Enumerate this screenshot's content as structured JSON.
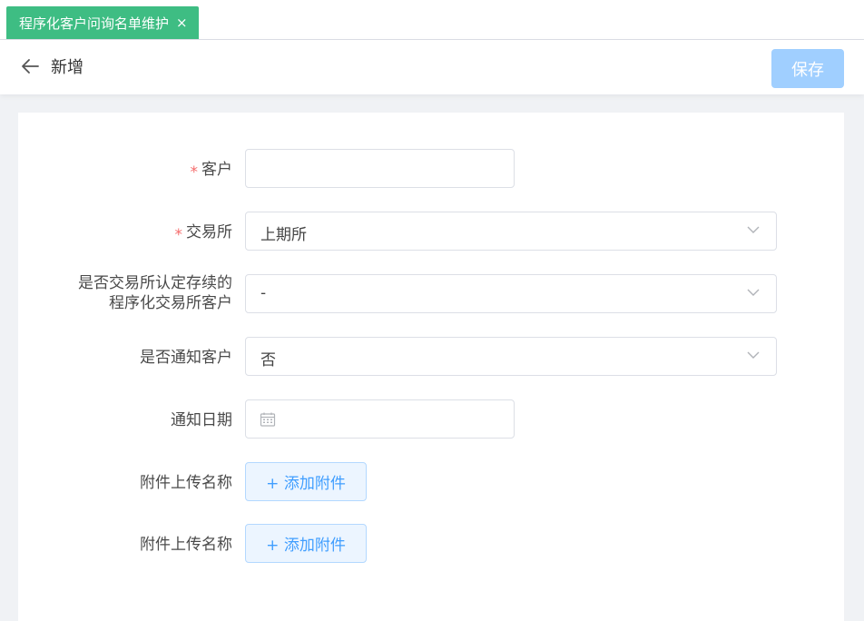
{
  "tab": {
    "title": "程序化客户问询名单维护",
    "close_glyph": "×"
  },
  "header": {
    "title": "新增",
    "save_label": "保存"
  },
  "form": {
    "required_mark": "*",
    "customer": {
      "label": "客户",
      "value": ""
    },
    "exchange": {
      "label": "交易所",
      "value": "上期所"
    },
    "recognized": {
      "label_line1": "是否交易所认定存续的",
      "label_line2": "程序化交易所客户",
      "value": "-"
    },
    "notify": {
      "label": "是否通知客户",
      "value": "否"
    },
    "notify_date": {
      "label": "通知日期",
      "value": ""
    },
    "attachment1": {
      "label": "附件上传名称",
      "button": "+ 添加附件"
    },
    "attachment2": {
      "label": "附件上传名称",
      "button": "+ 添加附件"
    }
  },
  "colors": {
    "tab_bg": "#3ebd83",
    "save_bg": "#a0cfff",
    "required": "#f56c6c",
    "link": "#409eff"
  }
}
